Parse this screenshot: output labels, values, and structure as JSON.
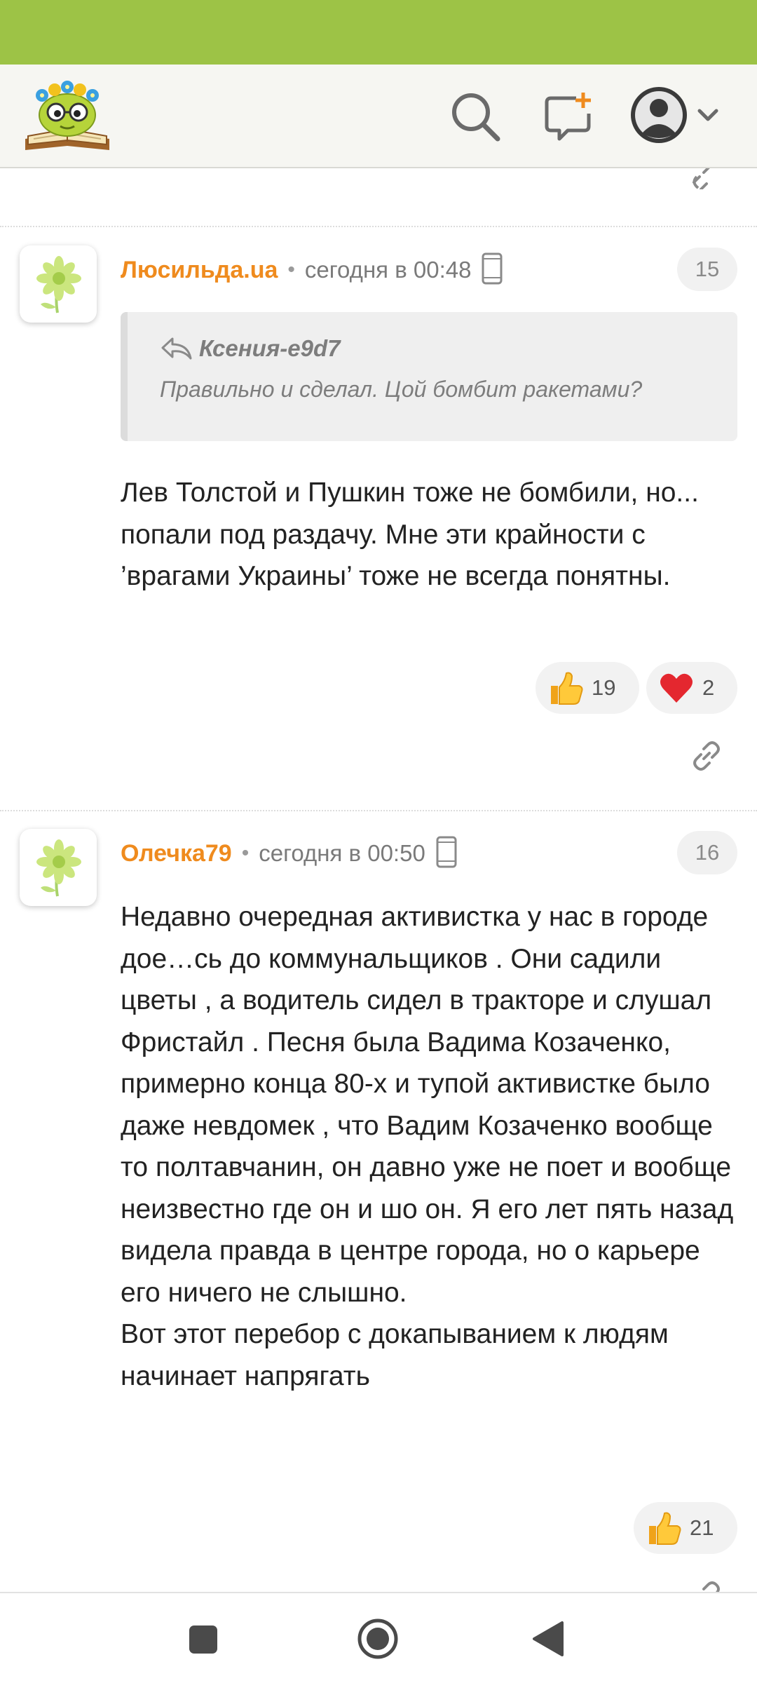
{
  "header": {
    "logo_icon": "reading-cat-logo",
    "search_icon": "search-icon",
    "new_post_icon": "new-message-icon",
    "avatar_icon": "user-avatar-icon",
    "brand_color": "#9dc346"
  },
  "comments": [
    {
      "author": "Люсильда.ua",
      "dot": "•",
      "date": "сегодня в 00:48",
      "number": "15",
      "quote": {
        "author": "Ксения-e9d7",
        "text": "Правильно и сделал. Цой бомбит ракетами?"
      },
      "text": "Лев Толстой и Пушкин тоже не бомбили, но... попали под раздачу. Мне эти крайности с ’врагами Украины’ тоже не всегда понятны.",
      "reactions": [
        {
          "icon": "thumbs-up-icon",
          "count": "19"
        },
        {
          "icon": "heart-icon",
          "count": "2"
        }
      ]
    },
    {
      "author": "Олечка79",
      "dot": "•",
      "date": "сегодня в 00:50",
      "number": "16",
      "text": "Недавно очередная активистка у нас в городе дое…сь до коммунальщиков . Они садили цветы , а водитель сидел в тракторе и слушал Фристайл . Песня была Вадима Козаченко, примерно конца 80-х и тупой активистке было даже невдомек , что Вадим Козаченко вообще то полтавчанин, он давно уже не поет и вообще неизвестно где он и шо он. Я его лет пять назад видела правда в центре города, но о карьере его ничего не слышно.\nВот этот перебор с докапыванием к людям начинает напрягать",
      "reactions": [
        {
          "icon": "thumbs-up-icon",
          "count": "21"
        }
      ]
    }
  ],
  "nav": {
    "recents_icon": "square-recents-icon",
    "home_icon": "circle-home-icon",
    "back_icon": "triangle-back-icon"
  }
}
